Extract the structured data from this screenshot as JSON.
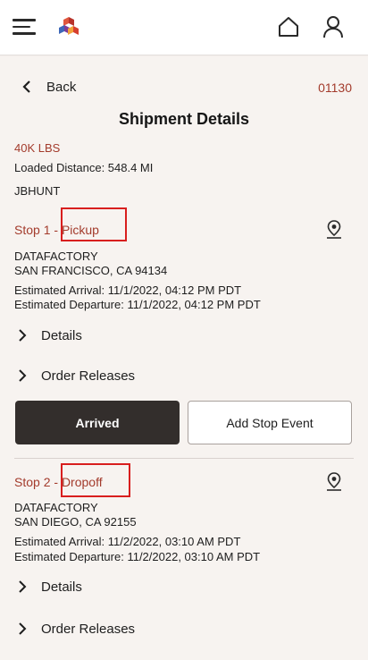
{
  "header": {
    "menu_icon": "hamburger-menu-icon",
    "logo_icon": "app-logo-icon",
    "home_icon": "home-icon",
    "profile_icon": "user-profile-icon"
  },
  "nav": {
    "back_label": "Back",
    "order_id": "01130"
  },
  "page": {
    "title": "Shipment Details",
    "weight": "40K LBS",
    "loaded_distance": "Loaded Distance: 548.4 MI",
    "carrier": "JBHUNT"
  },
  "stops": [
    {
      "label": "Stop 1",
      "separator": " - ",
      "type": "Pickup",
      "location_name": "DATAFACTORY",
      "address": "SAN FRANCISCO, CA 94134",
      "estimated_arrival": "Estimated Arrival: 11/1/2022, 04:12 PM PDT",
      "estimated_departure": "Estimated Departure: 11/1/2022, 04:12 PM PDT",
      "details_label": "Details",
      "order_releases_label": "Order Releases",
      "arrived_button": "Arrived",
      "add_stop_event_button": "Add Stop Event"
    },
    {
      "label": "Stop 2",
      "separator": " - ",
      "type": "Dropoff",
      "location_name": "DATAFACTORY",
      "address": "SAN DIEGO, CA 92155",
      "estimated_arrival": "Estimated Arrival: 11/2/2022, 03:10 AM PDT",
      "estimated_departure": "Estimated Departure: 11/2/2022, 03:10 AM PDT",
      "details_label": "Details",
      "order_releases_label": "Order Releases"
    }
  ],
  "colors": {
    "accent": "#a33b2c",
    "highlight_box": "#d81e1e",
    "primary_button": "#332e2c"
  }
}
